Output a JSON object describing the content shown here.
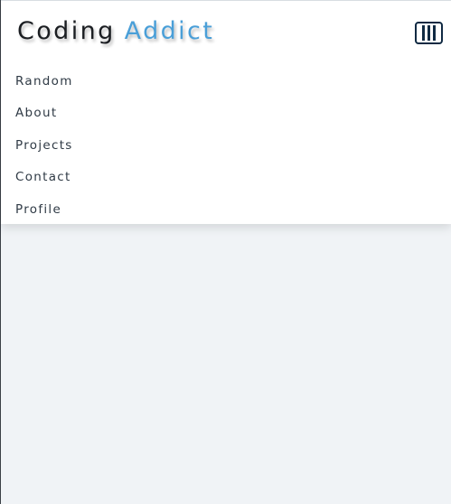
{
  "brand": {
    "word1": "Coding",
    "word2": "Addict"
  },
  "toggle": {
    "icon": "bars-icon"
  },
  "nav": {
    "links": [
      {
        "label": "Random"
      },
      {
        "label": "About"
      },
      {
        "label": "Projects"
      },
      {
        "label": "Contact"
      },
      {
        "label": "Profile"
      }
    ]
  },
  "colors": {
    "brand_dark": "#1b1e22",
    "brand_accent": "#4a9fd8",
    "page_background": "#f0f3f6",
    "toggle_border": "#102a43"
  }
}
